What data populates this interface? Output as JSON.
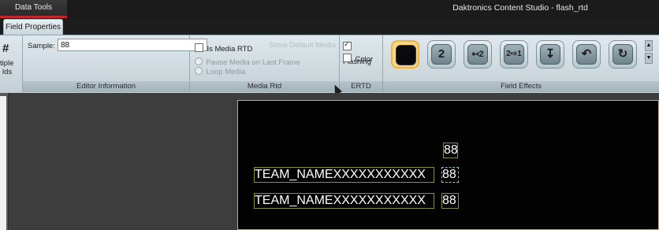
{
  "window": {
    "context_tab": "Data Tools",
    "title": "Daktronics Content Studio - flash_rtd",
    "active_tab": "Field Properties"
  },
  "ribbon": {
    "multiple_fields": {
      "icon": "#",
      "label_line1": "tiple",
      "label_line2": "lds"
    },
    "editor_information": {
      "label": "Editor Information",
      "sample_label": "Sample:",
      "sample_value": "88"
    },
    "media_rtd": {
      "label": "Media Rtd",
      "is_media_rtd": "Is Media RTD",
      "option_faded": "Show Default Media",
      "pause_media": "Pause Media on Last Frame",
      "loop_media": "Loop Media"
    },
    "ertd": {
      "label": "ERTD",
      "flashing": "Flashing",
      "flashing_checked": true,
      "color": "Color",
      "color_checked": false
    },
    "field_effects": {
      "label": "Field Effects",
      "effects": [
        {
          "icon": "blank-effect-icon",
          "glyph": ""
        },
        {
          "icon": "number-effect-icon",
          "glyph": "2"
        },
        {
          "icon": "slide-left-effect-icon",
          "glyph": "↤2"
        },
        {
          "icon": "push-right-effect-icon",
          "glyph": "2⇨1"
        },
        {
          "icon": "slide-down-effect-icon",
          "glyph": "↧"
        },
        {
          "icon": "rotate-effect-icon",
          "glyph": "↶"
        },
        {
          "icon": "wipe-effect-icon",
          "glyph": "↻"
        }
      ]
    }
  },
  "canvas": {
    "fields": [
      {
        "text": "88"
      },
      {
        "text": "TEAM_NAMEXXXXXXXXXXX"
      },
      {
        "text": "88"
      },
      {
        "text": "TEAM_NAMEXXXXXXXXXXX"
      },
      {
        "text": "88"
      }
    ]
  }
}
